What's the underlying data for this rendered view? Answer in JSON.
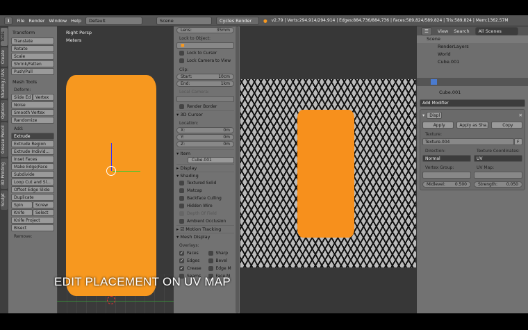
{
  "header": {
    "menus": [
      "File",
      "Render",
      "Window",
      "Help"
    ],
    "layout": "Default",
    "scene": "Scene",
    "engine": "Cycles Render",
    "stats": "v2.79 | Verts:294,914/294,914 | Edges:884,736/884,736 | Faces:589,824/589,824 | Tris:589,824 | Mem:1362.57M"
  },
  "tool_tabs": [
    "Tools",
    "Create",
    "Shading / UVs",
    "Options",
    "Grease Pencil",
    "3D Printing",
    "Sculpt"
  ],
  "tools": {
    "transform": "Transform",
    "transform_btns": [
      "Translate",
      "Rotate",
      "Scale",
      "Shrink/Fatten",
      "Push/Pull"
    ],
    "mesh_tools": "Mesh Tools",
    "deform": "Deform:",
    "slide_edge": "Slide Ed",
    "vertex": "Vertex",
    "deform_btns": [
      "Noise",
      "Smooth Vertex",
      "Randomize"
    ],
    "add": "Add:",
    "extrude": "Extrude",
    "add_btns": [
      "Extrude Region",
      "Extrude Individ...",
      "Inset Faces",
      "Make Edge/Face",
      "Subdivide",
      "Loop Cut and Sl...",
      "Offset Edge Slide",
      "Duplicate"
    ],
    "spin": "Spin",
    "screw": "Screw",
    "knife": "Knife",
    "select": "Select",
    "knife_project": "Knife Project",
    "bisect": "Bisect",
    "remove": "Remove:"
  },
  "viewport": {
    "view": "Right Persp",
    "units": "Meters"
  },
  "npanel": {
    "lens_label": "Lens:",
    "lens": "35mm",
    "lock_object": "Lock to Object:",
    "lock_cursor": "Lock to Cursor",
    "lock_camera": "Lock Camera to View",
    "clip": "Clip:",
    "start_label": "Start:",
    "start": "10cm",
    "end_label": "End:",
    "end": "1km",
    "local_camera": "Local Camera:",
    "render_border": "Render Border",
    "cursor": "3D Cursor",
    "location": "Location:",
    "x_label": "X:",
    "y_label": "Y:",
    "z_label": "Z:",
    "x": "0m",
    "y": "0m",
    "z": "0m",
    "item": "Item",
    "item_name": "Cube.001",
    "display": "Display",
    "shading": "Shading",
    "shading_opts": [
      "Textured Solid",
      "Matcap",
      "Backface Culling",
      "Hidden Wire",
      "Depth Of Field",
      "Ambient Occlusion"
    ],
    "motion_tracking": "Motion Tracking",
    "mesh_display": "Mesh Display",
    "overlays": "Overlays:",
    "faces": "Faces",
    "edges": "Edges",
    "crease": "Crease",
    "seams": "Seams",
    "sharp": "Sharp",
    "bevel": "Bevel",
    "edge_marks": "Edge M",
    "face_marks": "Face M"
  },
  "outliner": {
    "view": "View",
    "search": "Search",
    "filter": "All Scenes",
    "items": [
      "Scene",
      "RenderLayers",
      "World",
      "Cube.001"
    ]
  },
  "properties": {
    "object": "Cube.001",
    "add_modifier": "Add Modifier",
    "mod_name": "Displ",
    "apply": "Apply",
    "apply_shape": "Apply as Sha...",
    "copy": "Copy",
    "texture_label": "Texture:",
    "texture": "Texture.004",
    "f": "F",
    "direction_label": "Direction:",
    "direction": "Normal",
    "coords_label": "Texture Coordinates:",
    "coords": "UV",
    "vgroup_label": "Vertex Group:",
    "uvmap_label": "UV Map:",
    "midlevel_label": "Midlevel:",
    "midlevel": "0.500",
    "strength_label": "Strength:",
    "strength": "0.050"
  },
  "caption": "EDIT PLACEMENT ON UV MAP",
  "colors": {
    "object": "#f7981f",
    "header": "#555555",
    "panel": "#727272"
  }
}
